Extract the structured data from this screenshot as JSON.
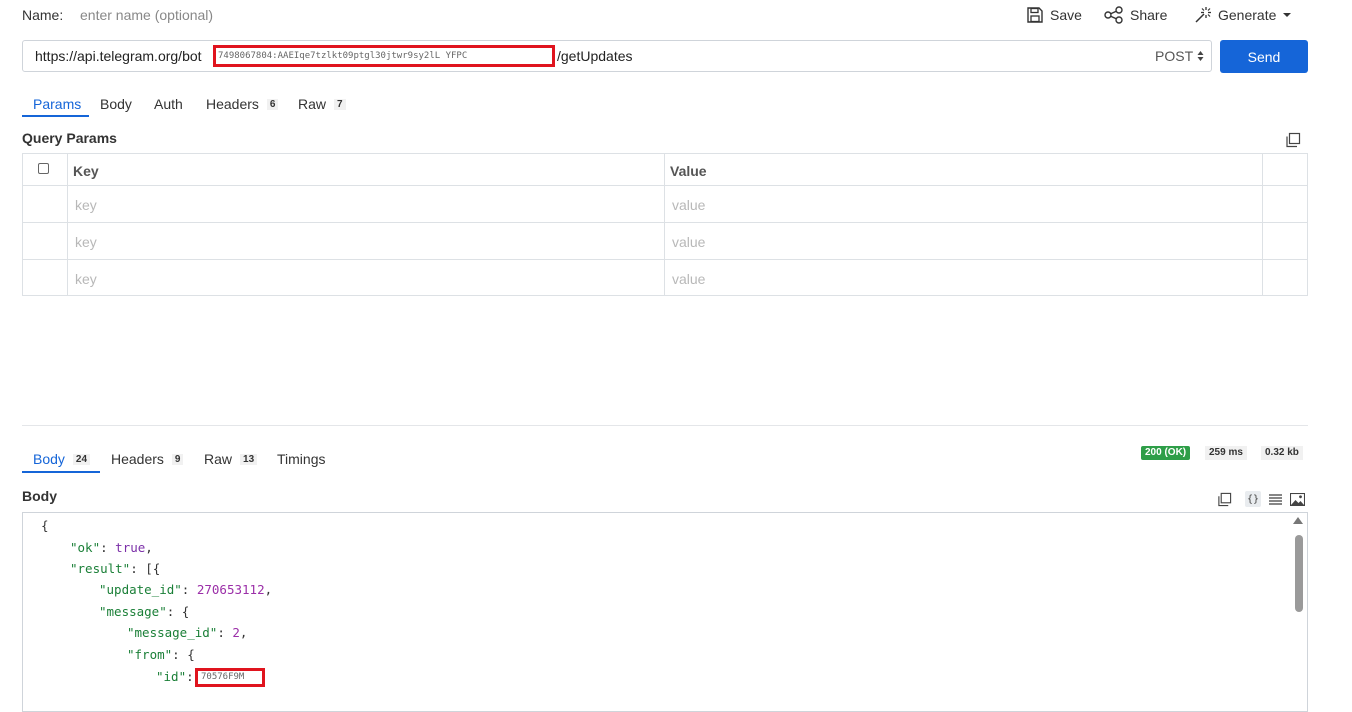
{
  "request": {
    "name_label": "Name:",
    "name_placeholder": "enter name (optional)",
    "actions": {
      "save": "Save",
      "share": "Share",
      "generate": "Generate"
    },
    "url_prefix": "https://api.telegram.org/bot",
    "url_redacted_token": "7498067804:AAEIqe7tzlkt09ptgl30jtwr9sy2lL YFPC",
    "url_suffix": "/getUpdates",
    "method": "POST",
    "send_label": "Send",
    "tabs": [
      {
        "label": "Params",
        "badge": ""
      },
      {
        "label": "Body",
        "badge": ""
      },
      {
        "label": "Auth",
        "badge": ""
      },
      {
        "label": "Headers",
        "badge": "6"
      },
      {
        "label": "Raw",
        "badge": "7"
      }
    ],
    "query_params_title": "Query Params",
    "table_headers": {
      "key": "Key",
      "value": "Value"
    },
    "rows": [
      {
        "key_placeholder": "key",
        "value_placeholder": "value"
      },
      {
        "key_placeholder": "key",
        "value_placeholder": "value"
      },
      {
        "key_placeholder": "key",
        "value_placeholder": "value"
      }
    ]
  },
  "response": {
    "tabs": [
      {
        "label": "Body",
        "badge": "24"
      },
      {
        "label": "Headers",
        "badge": "9"
      },
      {
        "label": "Raw",
        "badge": "13"
      },
      {
        "label": "Timings",
        "badge": ""
      }
    ],
    "status": "200 (OK)",
    "time": "259 ms",
    "size": "0.32 kb",
    "body_title": "Body",
    "code": {
      "line1": "{",
      "ok_key": "\"ok\"",
      "ok_value": "true",
      "result_key": "\"result\"",
      "result_open": "[{",
      "update_id_key": "\"update_id\"",
      "update_id_value": "270653112",
      "message_key": "\"message\"",
      "message_id_key": "\"message_id\"",
      "message_id_value": "2",
      "from_key": "\"from\"",
      "id_key": "\"id\"",
      "id_redacted": "70576F9M"
    }
  },
  "colors": {
    "accent": "#1565d8",
    "status_ok": "#2e9e48",
    "redaction": "#e0141e",
    "json_key": "#1a7f37",
    "json_number": "#9b2fa8"
  }
}
